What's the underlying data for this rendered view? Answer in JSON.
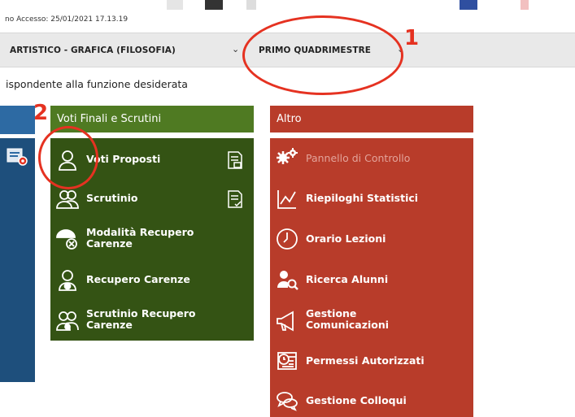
{
  "header": {
    "last_access": "no Accesso: 25/01/2021 17.13.19"
  },
  "selectors": {
    "class_label": "ARTISTICO - GRAFICA (FILOSOFIA)",
    "period_label": "PRIMO QUADRIMESTRE"
  },
  "instruction": "ispondente alla funzione desiderata",
  "green_panel": {
    "title": "Voti Finali e Scrutini",
    "items": [
      {
        "label": "Voti Proposti",
        "icon": "user-icon"
      },
      {
        "label": "Scrutinio",
        "icon": "users-icon"
      },
      {
        "label": "Modalità Recupero\nCarenze",
        "icon": "umbrella-user-icon"
      },
      {
        "label": "Recupero Carenze",
        "icon": "user-lock-icon"
      },
      {
        "label": "Scrutinio Recupero\nCarenze",
        "icon": "users-lock-icon"
      }
    ]
  },
  "red_panel": {
    "title": "Altro",
    "items": [
      {
        "label": "Pannello di Controllo",
        "icon": "gears-icon",
        "disabled": true
      },
      {
        "label": "Riepiloghi Statistici",
        "icon": "chart-icon"
      },
      {
        "label": "Orario Lezioni",
        "icon": "clock-icon"
      },
      {
        "label": "Ricerca Alunni",
        "icon": "user-search-icon"
      },
      {
        "label": "Gestione\nComunicazioni",
        "icon": "megaphone-icon"
      },
      {
        "label": "Permessi Autorizzati",
        "icon": "calendar-clock-icon"
      },
      {
        "label": "Gestione Colloqui",
        "icon": "chat-bubbles-icon"
      }
    ]
  },
  "annotations": {
    "one": "1",
    "two": "2"
  },
  "colors": {
    "green_header": "#4f7a22",
    "green_body": "#345314",
    "red": "#b83c2a",
    "blue": "#1e4f7c",
    "annotation_red": "#e53221"
  }
}
